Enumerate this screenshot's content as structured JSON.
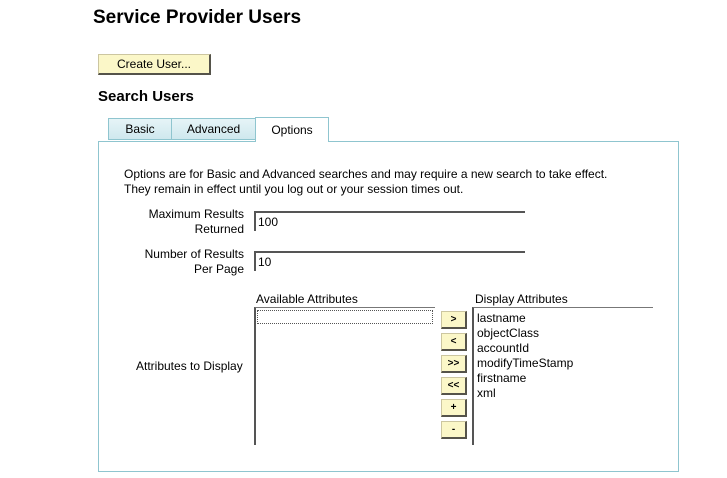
{
  "page": {
    "title": "Service Provider Users"
  },
  "create_button": {
    "label": "Create User..."
  },
  "search": {
    "title": "Search Users"
  },
  "tabs": [
    {
      "label": "Basic",
      "active": false
    },
    {
      "label": "Advanced",
      "active": false
    },
    {
      "label": "Options",
      "active": true
    }
  ],
  "options": {
    "description_line1": "Options are for Basic and Advanced searches and may require a new search to take effect.",
    "description_line2": "They remain in effect until you log out or your session times out.",
    "max_results": {
      "label_line1": "Maximum Results",
      "label_line2": "Returned",
      "value": "100"
    },
    "results_per_page": {
      "label_line1": "Number of Results",
      "label_line2": "Per Page",
      "value": "10"
    },
    "attributes": {
      "label": "Attributes to Display",
      "available_header": "Available Attributes",
      "display_header": "Display Attributes",
      "available_items": [],
      "display_items": [
        "lastname",
        "objectClass",
        "accountId",
        "modifyTimeStamp",
        "firstname",
        "xml"
      ],
      "buttons": {
        "move_right": ">",
        "move_left": "<",
        "move_all_right": ">>",
        "move_all_left": "<<",
        "move_up": "+",
        "move_down": "-"
      }
    }
  }
}
